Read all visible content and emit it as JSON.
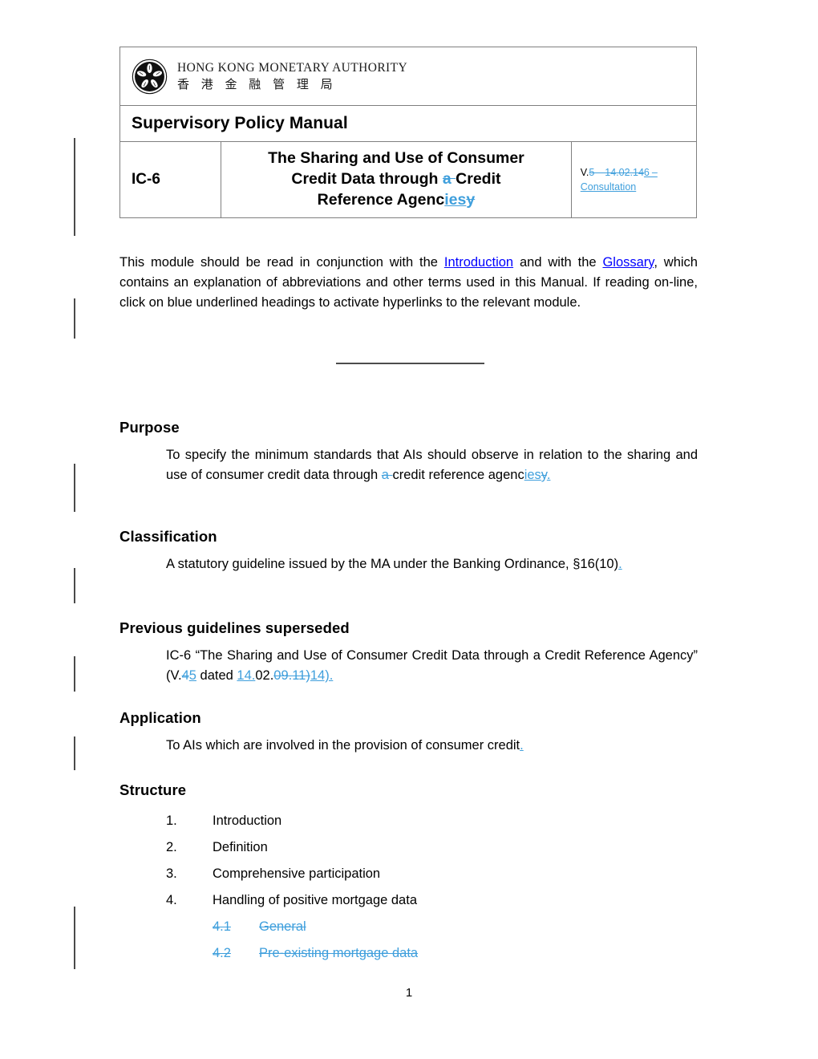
{
  "header": {
    "logo": {
      "english": "HONG KONG MONETARY AUTHORITY",
      "chinese": "香 港 金 融 管 理 局"
    },
    "manual_title": "Supervisory Policy Manual",
    "module_code": "IC-6",
    "doc_title": {
      "line1": "The Sharing and Use of Consumer",
      "line2_pre": "Credit Data through ",
      "line2_del": "a ",
      "line2_post": "Credit",
      "line3_pre": "Reference Agenc",
      "line3_ins": "ies",
      "line3_del": "y"
    },
    "version": {
      "prefix": "V.",
      "deleted": "5 – 14.02.14",
      "inserted": "6 – Consultation"
    }
  },
  "intro_paragraph": {
    "part1": "This module should be read in conjunction with the ",
    "link1": "Introduction",
    "part2": " and with the ",
    "link2": "Glossary",
    "part3": ", which contains an explanation of abbreviations and other terms used in this Manual.  If reading on-line, click on blue underlined headings to activate hyperlinks to the relevant module."
  },
  "sections": {
    "purpose": {
      "heading": "Purpose",
      "body_pre": "To specify the minimum standards that AIs should observe in relation to the sharing and use of consumer credit data through ",
      "body_del1": "a ",
      "body_mid": "credit reference agenc",
      "body_ins": "ies",
      "body_del2": "y",
      "body_ins2": "."
    },
    "classification": {
      "heading": "Classification",
      "body": "A statutory guideline issued by the MA under the Banking Ordinance, §16(10)",
      "body_ins": "."
    },
    "previous": {
      "heading": "Previous guidelines superseded",
      "body_pre": "IC-6 “The Sharing and Use of Consumer Credit Data through a Credit Reference Agency” (V.",
      "ver_del": "4",
      "ver_ins": "5",
      "mid": " dated ",
      "date_ins1": "14.",
      "date_plain": "02.",
      "date_del": "09.11)",
      "date_ins2": "14)."
    },
    "application": {
      "heading": "Application",
      "body": "To AIs which are involved in the provision of consumer credit",
      "body_ins": "."
    },
    "structure": {
      "heading": "Structure",
      "items": [
        {
          "num": "1.",
          "label": "Introduction",
          "state": "normal"
        },
        {
          "num": "2.",
          "label": "Definition",
          "state": "normal"
        },
        {
          "num": "3.",
          "label": "Comprehensive participation",
          "state": "normal"
        },
        {
          "num": "4.",
          "label": "Handling of positive mortgage data",
          "state": "normal"
        }
      ],
      "subitems": [
        {
          "num": "4.1",
          "label": "General",
          "state": "deleted"
        },
        {
          "num": "4.2",
          "label": "Pre-existing mortgage data",
          "state": "deleted"
        }
      ]
    }
  },
  "footer": {
    "page_number": "1"
  },
  "colors": {
    "tracked_change": "#3f9fdc",
    "hyperlink": "#0000ff",
    "border": "#7f7f7f",
    "change_bar": "#4a4a4a"
  }
}
